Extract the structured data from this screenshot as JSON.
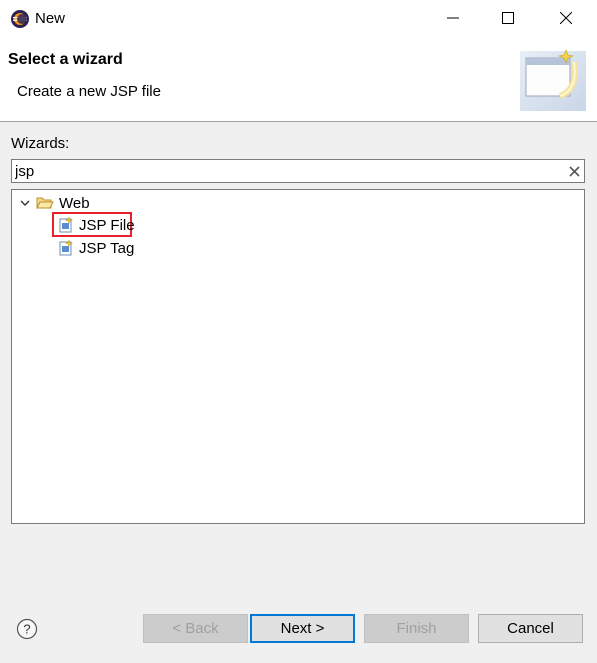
{
  "window": {
    "title": "New",
    "icon": "eclipse-icon",
    "controls": [
      "minimize-icon",
      "maximize-icon",
      "close-icon"
    ]
  },
  "header": {
    "title": "Select a wizard",
    "description": "Create a new JSP file",
    "banner_icon": "new-wizard-banner-icon"
  },
  "wizards": {
    "label": "Wizards:",
    "filter_value": "jsp",
    "clear_icon": "clear-icon",
    "tree": {
      "category": {
        "label": "Web",
        "expanded": true,
        "icon": "folder-open-icon"
      },
      "items": [
        {
          "label": "JSP File",
          "icon": "jsp-file-icon",
          "selected": true
        },
        {
          "label": "JSP Tag",
          "icon": "jsp-tag-icon",
          "selected": false
        }
      ]
    }
  },
  "footer": {
    "help_icon": "help-icon",
    "buttons": {
      "back": "< Back",
      "next": "Next >",
      "finish": "Finish",
      "cancel": "Cancel"
    }
  },
  "colors": {
    "highlight": "#e8202a",
    "default_button_border": "#0078d7"
  }
}
